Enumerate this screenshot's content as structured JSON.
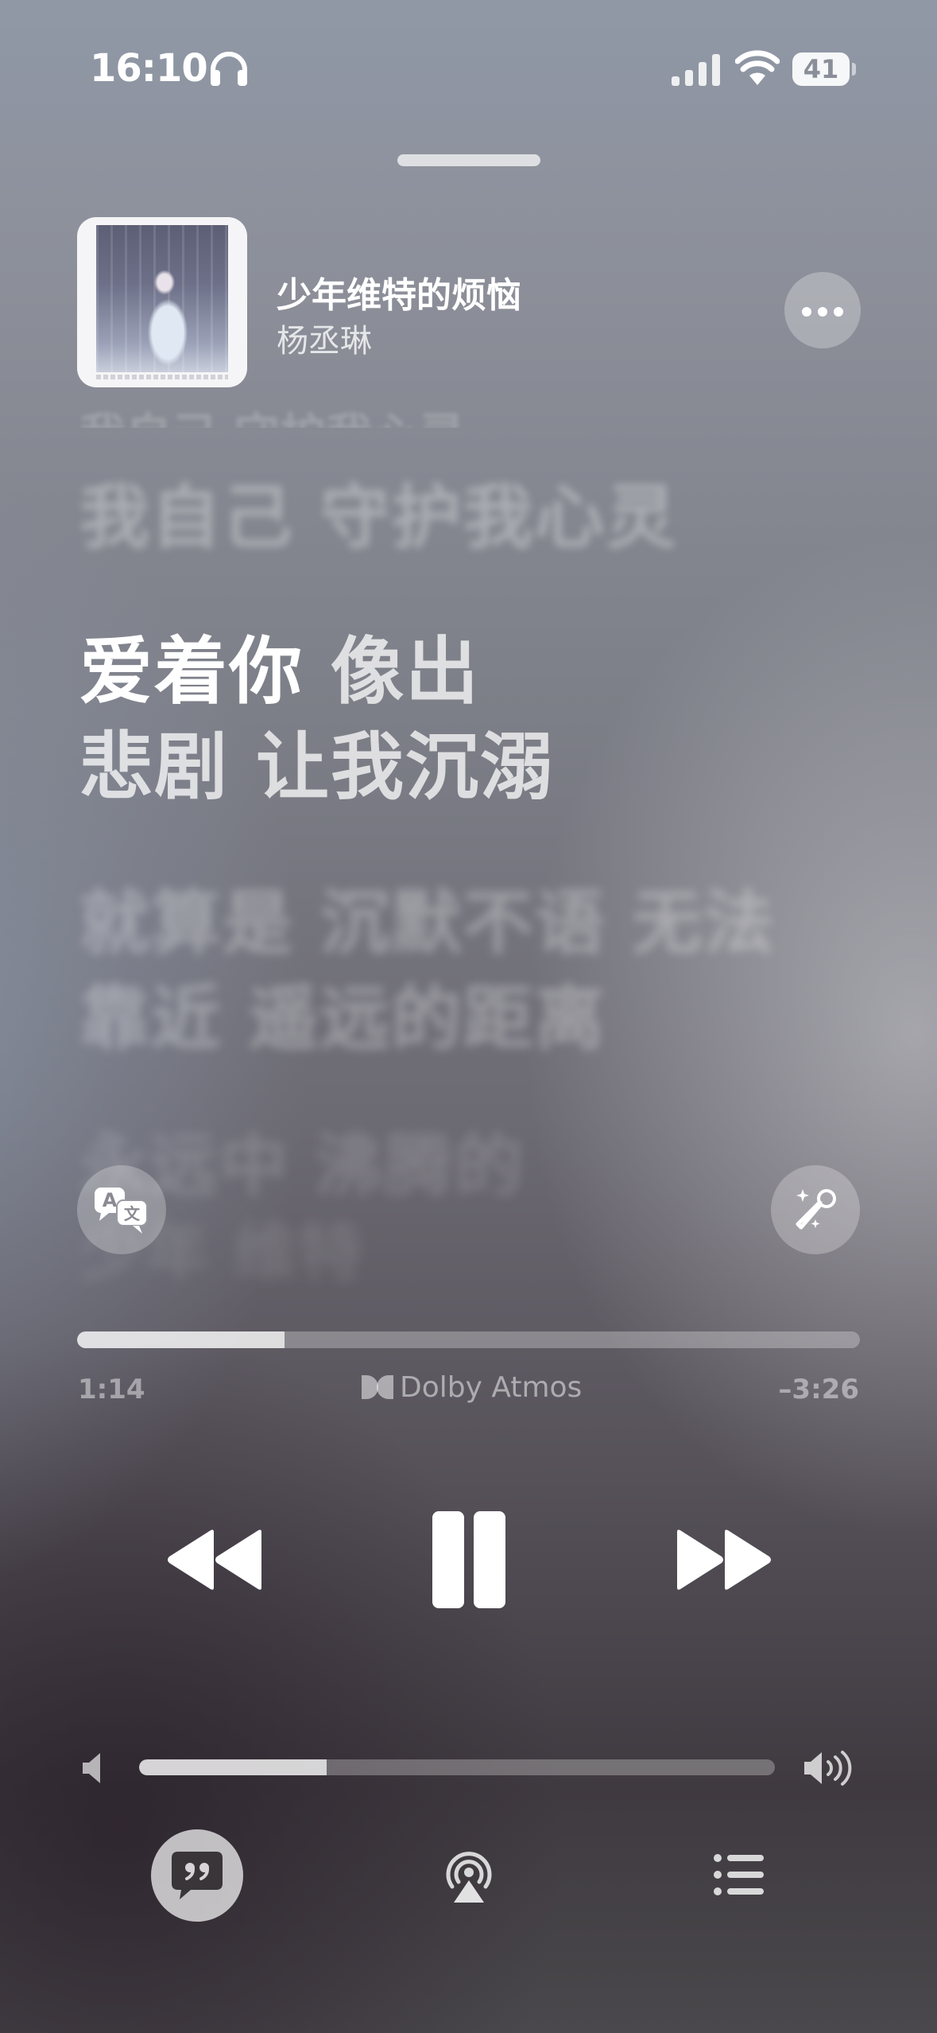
{
  "status_bar": {
    "time": "16:10",
    "battery": "41",
    "icons": [
      "headphones-icon",
      "cellular-signal-icon",
      "wifi-icon",
      "battery-icon"
    ]
  },
  "now_playing": {
    "title": "少年维特的烦恼",
    "artist": "杨丞琳"
  },
  "lyrics": {
    "faded_top": "我自己 守护我心灵",
    "previous": "我自己 守护我心灵",
    "current_line1_active": "爱着你",
    "current_line1_rest": " 像出",
    "current_line2": "悲剧 让我沉溺",
    "next_line1": "就算是 沉默不语 无法",
    "next_line2": "靠近 遥远的距离",
    "next_line3": "永远中 沸腾的",
    "next_line4": "少年 维特"
  },
  "playback": {
    "elapsed": "1:14",
    "remaining": "–3:26",
    "progress_fraction": 0.265,
    "audio_format": "Dolby Atmos"
  },
  "volume": {
    "level_fraction": 0.295
  },
  "colors": {
    "foreground": "#ffffff",
    "track": "rgba(255,255,255,0.28)",
    "fill": "rgba(255,255,255,0.72)"
  }
}
